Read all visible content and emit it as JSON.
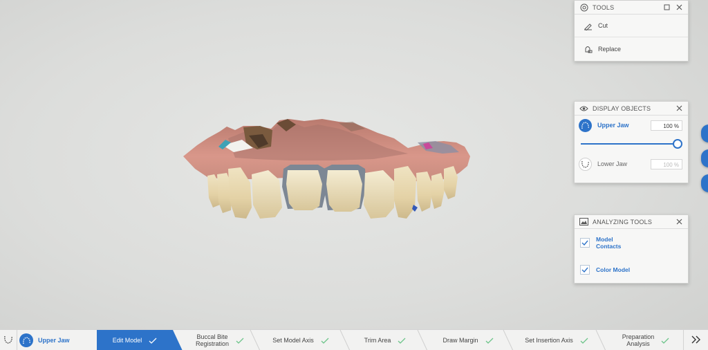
{
  "tools_panel": {
    "title": "TOOLS",
    "items": [
      {
        "label": "Cut",
        "icon": "cut-pen-icon"
      },
      {
        "label": "Replace",
        "icon": "replace-icon"
      }
    ]
  },
  "display_objects": {
    "title": "DISPLAY OBJECTS",
    "upper_jaw": {
      "label": "Upper Jaw",
      "opacity": "100 %",
      "opacity_value": 100,
      "active": true
    },
    "lower_jaw": {
      "label": "Lower Jaw",
      "opacity": "100 %",
      "active": false
    }
  },
  "analyzing_tools": {
    "title": "ANALYZING TOOLS",
    "items": [
      {
        "label_line1": "Model",
        "label_line2": "Contacts",
        "checked": true
      },
      {
        "label_line1": "Color Model",
        "label_line2": "",
        "checked": true
      }
    ]
  },
  "workflow": {
    "jaw_label": "Upper Jaw",
    "steps": [
      {
        "label": "Edit Model",
        "done": true,
        "active": true
      },
      {
        "label_line1": "Buccal Bite",
        "label_line2": "Registration",
        "done": true
      },
      {
        "label": "Set Model Axis",
        "done": true
      },
      {
        "label": "Trim Area",
        "done": true
      },
      {
        "label": "Draw Margin",
        "done": true
      },
      {
        "label": "Set Insertion Axis",
        "done": true
      },
      {
        "label_line1": "Preparation",
        "label_line2": "Analysis",
        "done": true
      }
    ]
  },
  "colors": {
    "accent": "#2d73c9",
    "check": "#6cc48a"
  }
}
